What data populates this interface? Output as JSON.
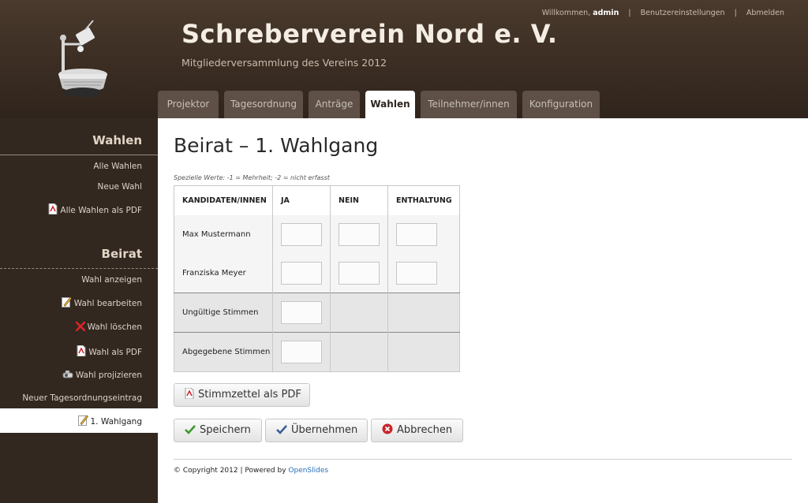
{
  "header": {
    "title": "Schreberverein Nord e. V.",
    "subtitle": "Mitgliederversammlung des Vereins 2012",
    "welcome_prefix": "Willkommen, ",
    "username": "admin",
    "separator": "|",
    "settings_link": "Benutzereinstellungen",
    "logout_link": "Abmelden"
  },
  "tabs": [
    {
      "label": "Projektor"
    },
    {
      "label": "Tagesordnung"
    },
    {
      "label": "Anträge"
    },
    {
      "label": "Wahlen",
      "active": true
    },
    {
      "label": "Teilnehmer/innen"
    },
    {
      "label": "Konfiguration"
    }
  ],
  "sidebar": {
    "section1_title": "Wahlen",
    "section1_items": [
      {
        "label": "Alle Wahlen"
      },
      {
        "label": "Neue Wahl"
      },
      {
        "label": "Alle Wahlen als PDF",
        "icon": "pdf-icon"
      }
    ],
    "section2_title": "Beirat",
    "section2_items": [
      {
        "label": "Wahl anzeigen"
      },
      {
        "label": "Wahl bearbeiten",
        "icon": "edit-icon"
      },
      {
        "label": "Wahl löschen",
        "icon": "delete-icon"
      },
      {
        "label": "Wahl als PDF",
        "icon": "pdf-icon"
      },
      {
        "label": "Wahl projizieren",
        "icon": "projector-icon"
      },
      {
        "label": "Neuer Tagesordnungseintrag"
      },
      {
        "label": "1. Wahlgang",
        "icon": "edit-icon",
        "active": true
      }
    ]
  },
  "main": {
    "title": "Beirat – 1. Wahlgang",
    "special_values_note": "Spezielle Werte: -1 = Mehrheit; -2 = nicht erfasst",
    "table": {
      "headers": [
        "KANDIDATEN/INNEN",
        "JA",
        "NEIN",
        "ENTHALTUNG"
      ],
      "candidates": [
        "Max Mustermann",
        "Franziska Meyer"
      ],
      "invalid_label": "Ungültige Stimmen",
      "cast_label": "Abgegebene Stimmen"
    },
    "pdf_button": "Stimmzettel als PDF",
    "save_button": "Speichern",
    "apply_button": "Übernehmen",
    "cancel_button": "Abbrechen"
  },
  "footer": {
    "text": "© Copyright 2012 | Powered by ",
    "link": "OpenSlides"
  },
  "colors": {
    "header_bg": "#3a2c22",
    "sidebar_bg": "#322820",
    "tab_bg": "#5e5047",
    "link": "#2a6ebb"
  }
}
